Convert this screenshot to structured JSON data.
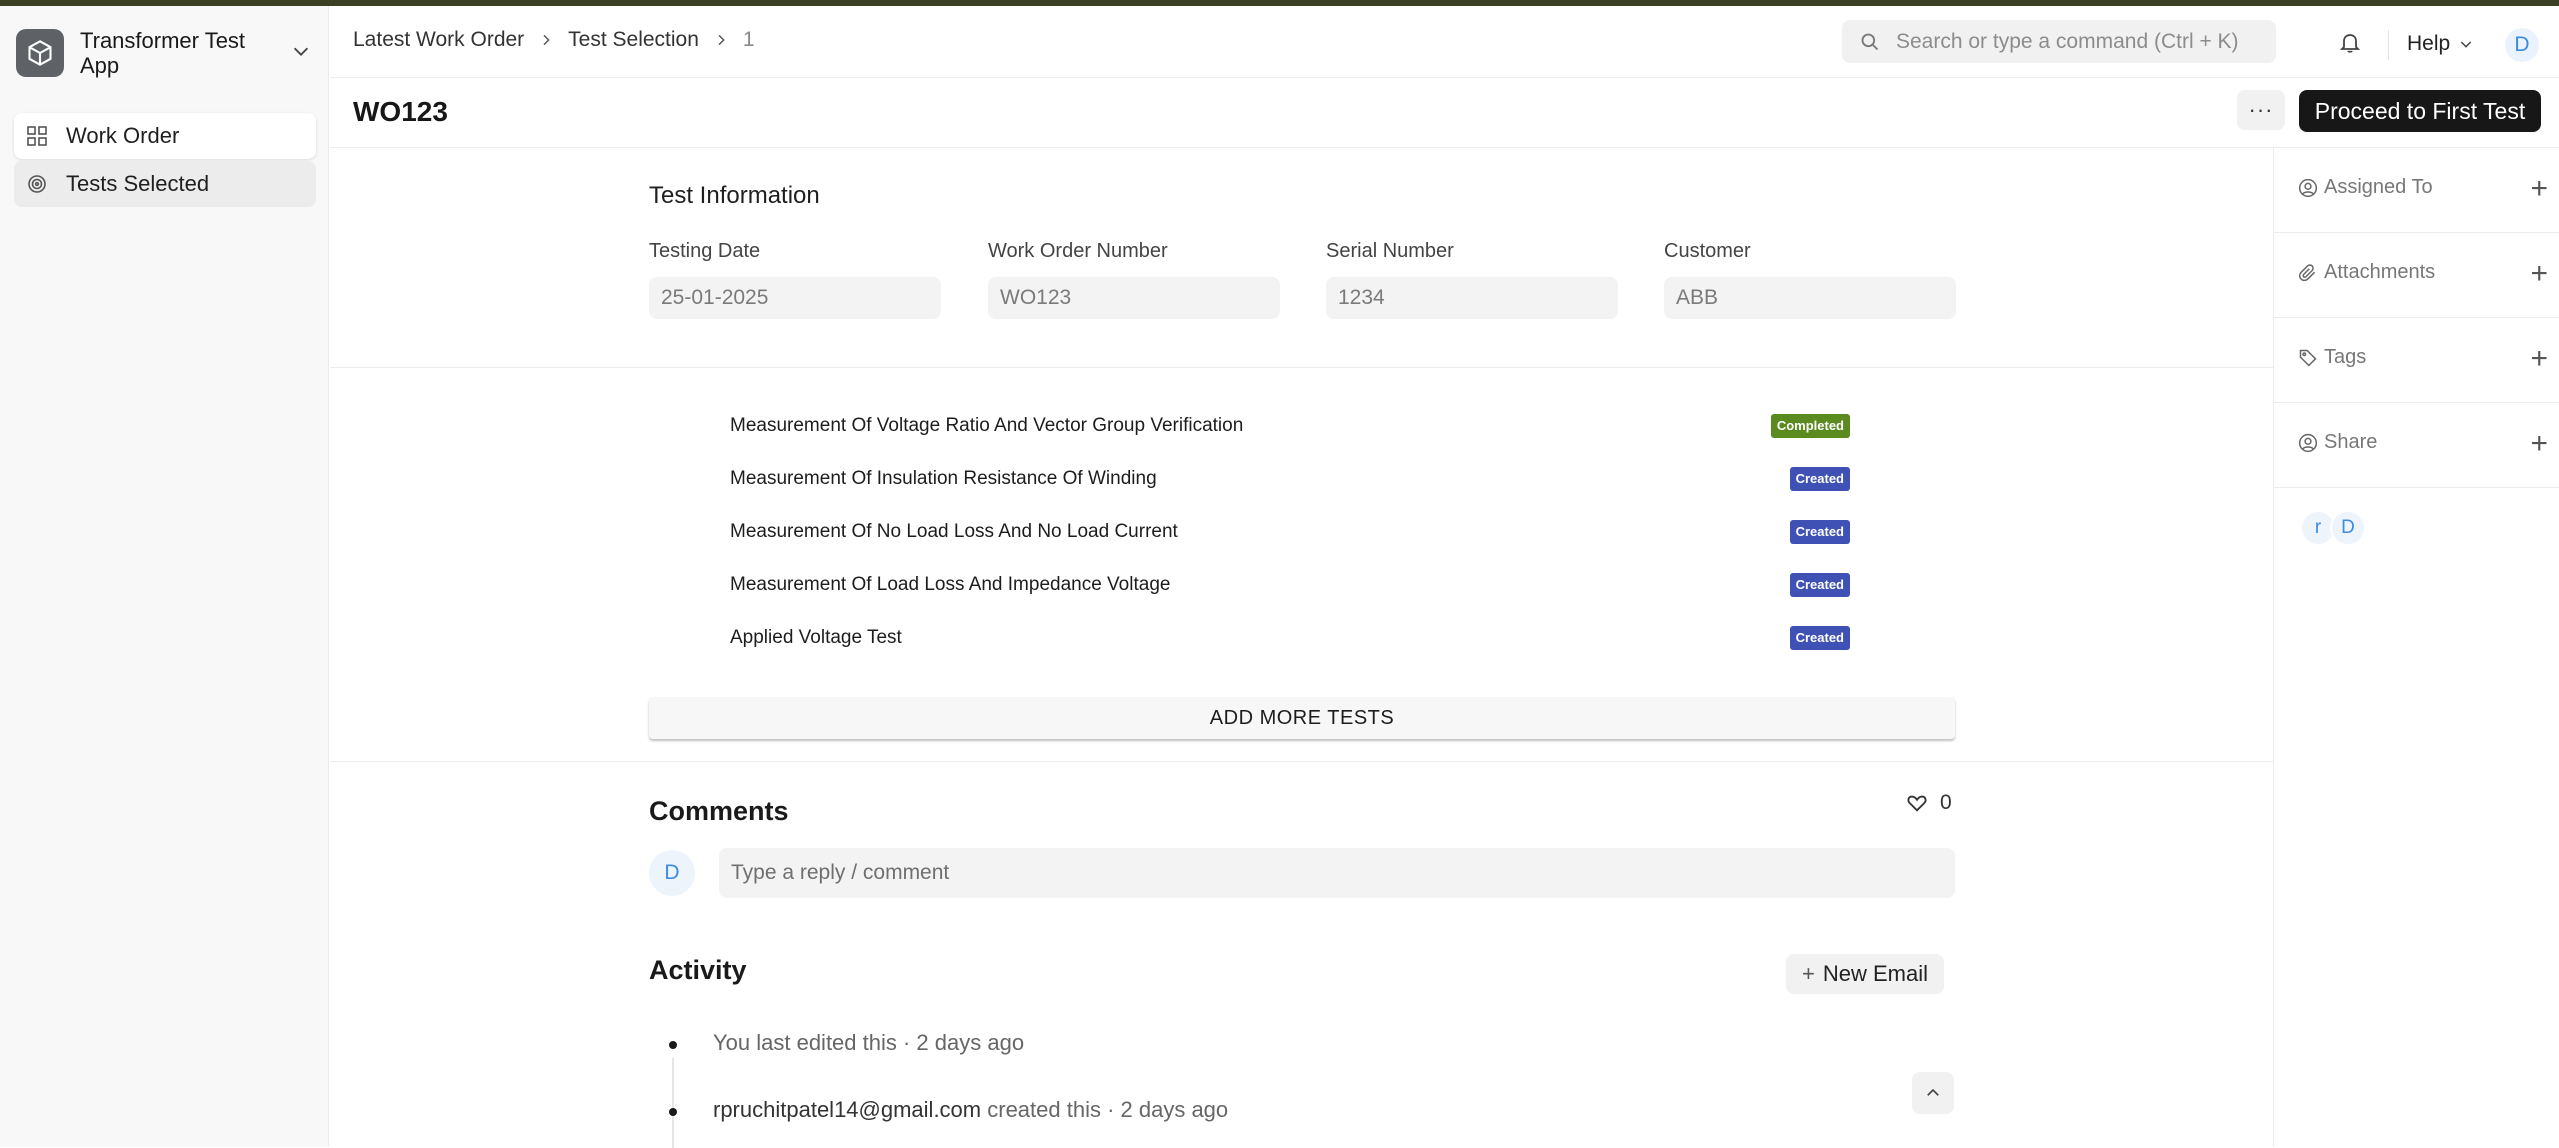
{
  "app": {
    "title": "Transformer Test App"
  },
  "sidebar": {
    "items": [
      {
        "label": "Work Order",
        "icon": "grid-icon"
      },
      {
        "label": "Tests Selected",
        "icon": "target-icon"
      }
    ]
  },
  "breadcrumb": [
    "Latest Work Order",
    "Test Selection",
    "1"
  ],
  "search": {
    "placeholder": "Search or type a command (Ctrl + K)"
  },
  "header": {
    "help_label": "Help",
    "user_initial": "D"
  },
  "doc": {
    "title": "WO123",
    "more_label": "···",
    "primary_action": "Proceed to First Test"
  },
  "test_info": {
    "title": "Test Information",
    "fields": [
      {
        "label": "Testing Date",
        "value": "25-01-2025"
      },
      {
        "label": "Work Order Number",
        "value": "WO123"
      },
      {
        "label": "Serial Number",
        "value": "1234"
      },
      {
        "label": "Customer",
        "value": "ABB"
      }
    ]
  },
  "tests": [
    {
      "name": "Measurement Of Voltage Ratio And Vector Group Verification",
      "status": "Completed"
    },
    {
      "name": "Measurement Of Insulation Resistance Of Winding",
      "status": "Created"
    },
    {
      "name": "Measurement Of No Load Loss And No Load Current",
      "status": "Created"
    },
    {
      "name": "Measurement Of Load Loss And Impedance Voltage",
      "status": "Created"
    },
    {
      "name": "Applied Voltage Test",
      "status": "Created"
    }
  ],
  "add_tests_label": "ADD MORE TESTS",
  "comments": {
    "title": "Comments",
    "likes": "0",
    "avatar_initial": "D",
    "placeholder": "Type a reply / comment"
  },
  "activity": {
    "title": "Activity",
    "new_email_label": "New Email",
    "entries": [
      {
        "actor": "",
        "text": "You last edited this · 2 days ago"
      },
      {
        "actor": "rpruchitpatel14@gmail.com",
        "text": " created this · 2 days ago"
      }
    ]
  },
  "right_panel": {
    "items": [
      {
        "label": "Assigned To"
      },
      {
        "label": "Attachments"
      },
      {
        "label": "Tags"
      },
      {
        "label": "Share"
      }
    ],
    "avatars": [
      "r",
      "D"
    ]
  },
  "colors": {
    "completed": "#5b8a1f",
    "created": "#3f51b5",
    "primary": "#171717",
    "accent_blue": "#3b8be0"
  }
}
